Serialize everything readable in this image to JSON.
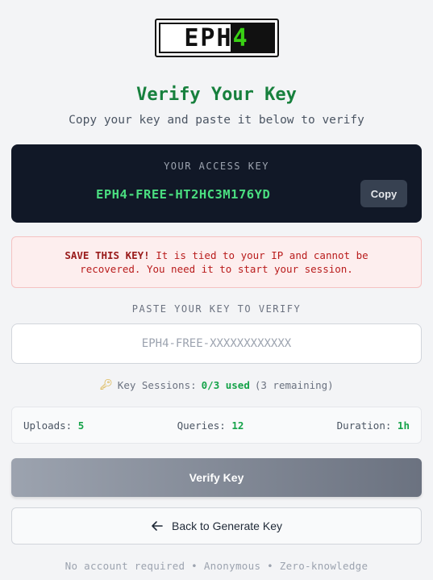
{
  "logo": {
    "text_a": "EPH",
    "text_b": "4"
  },
  "header": {
    "title": "Verify Your Key",
    "subtitle": "Copy your key and paste it below to verify"
  },
  "access_key": {
    "label": "YOUR ACCESS KEY",
    "value": "EPH4-FREE-HT2HC3M176YD",
    "copy_label": "Copy"
  },
  "warning": {
    "strong": "SAVE THIS KEY!",
    "line1_rest": " It is tied to your IP and cannot be",
    "line2": "recovered. You need it to start your session."
  },
  "verify_input": {
    "label": "PASTE YOUR KEY TO VERIFY",
    "placeholder": "EPH4-FREE-XXXXXXXXXXXX",
    "value": ""
  },
  "sessions": {
    "icon": "key-icon",
    "label": "Key Sessions:",
    "used": "0/3 used",
    "remaining": "(3 remaining)"
  },
  "stats": {
    "uploads_label": "Uploads:",
    "uploads_value": "5",
    "queries_label": "Queries:",
    "queries_value": "12",
    "duration_label": "Duration:",
    "duration_value": "1h"
  },
  "actions": {
    "verify_label": "Verify Key",
    "back_label": "Back to Generate Key"
  },
  "footer": {
    "text": "No account required • Anonymous • Zero-knowledge"
  },
  "colors": {
    "accent_green": "#17803d",
    "key_green": "#4ade80",
    "card_dark": "#111827",
    "warning_red": "#b91c1c"
  }
}
